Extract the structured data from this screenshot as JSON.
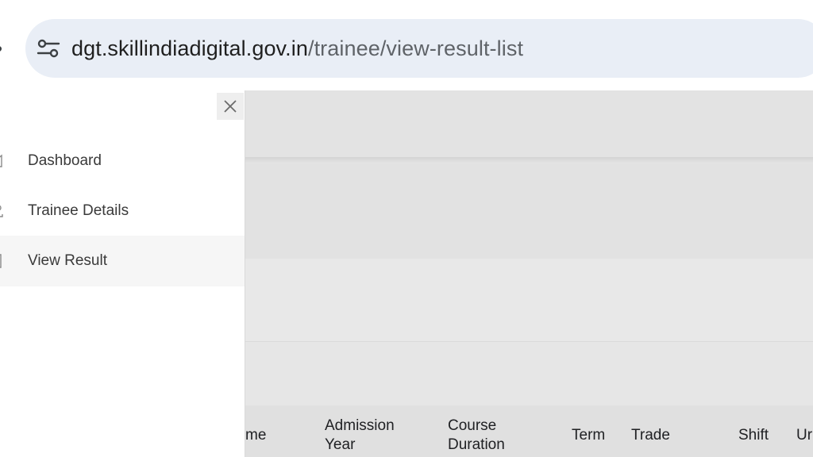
{
  "browser": {
    "url_host": "dgt.skillindiadigital.gov.in",
    "url_path": "/trainee/view-result-list",
    "icons": {
      "back": "back-arrow-icon",
      "site_info": "tune-icon"
    }
  },
  "drawer": {
    "close_icon": "close-icon",
    "items": [
      {
        "label": "Dashboard",
        "icon": "home-icon",
        "active": false
      },
      {
        "label": "Trainee Details",
        "icon": "user-icon",
        "active": false
      },
      {
        "label": "View Result",
        "icon": "document-icon",
        "active": true
      }
    ]
  },
  "table": {
    "headers": [
      {
        "lines": [
          "me"
        ]
      },
      {
        "lines": [
          "Admission",
          "Year"
        ]
      },
      {
        "lines": [
          "Course",
          "Duration"
        ]
      },
      {
        "lines": [
          "Term"
        ]
      },
      {
        "lines": [
          "Trade"
        ]
      },
      {
        "lines": [
          "Shift"
        ]
      },
      {
        "lines": [
          "Ur"
        ]
      }
    ]
  },
  "colors": {
    "omnibox_bg": "#e9eef6",
    "overlay_bg": "#e5e5e5",
    "drawer_bg": "#ffffff",
    "active_item_bg": "#f6f6f6"
  }
}
